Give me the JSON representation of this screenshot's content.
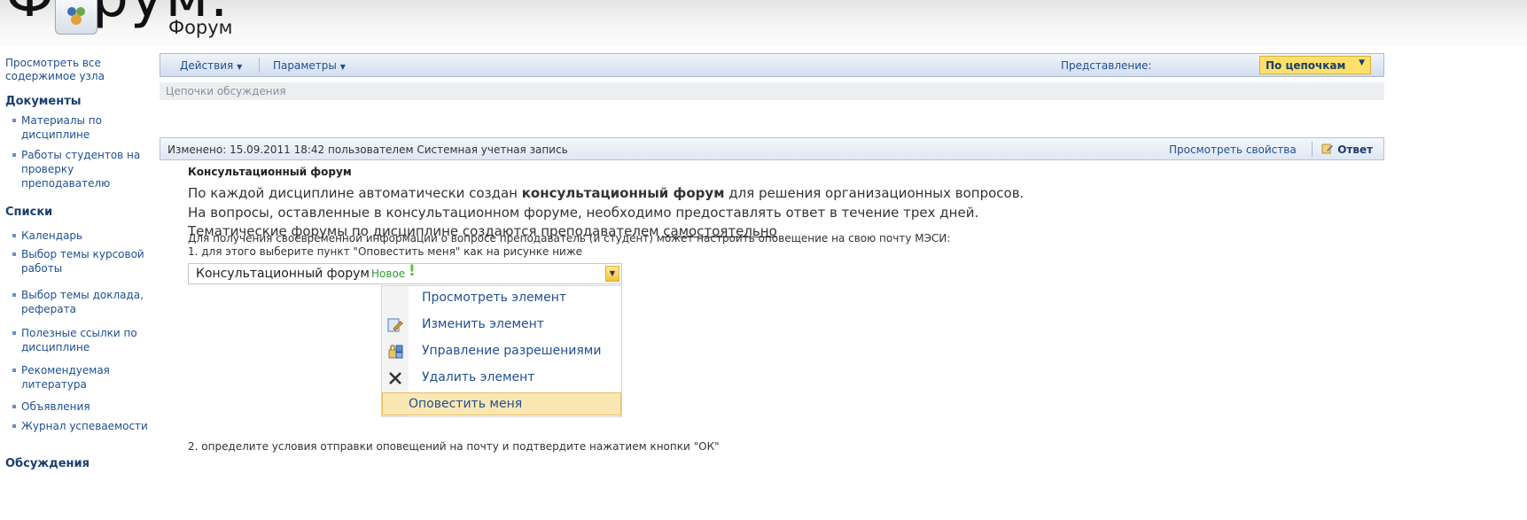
{
  "slide": {
    "overlay_title": "Форум."
  },
  "header": {
    "page_title": "Форум"
  },
  "nav": {
    "view_all": "Просмотреть все содержимое узла",
    "sections": [
      {
        "title": "Документы",
        "items": [
          "Материалы по дисциплине",
          "Работы студентов на проверку преподавателю"
        ]
      },
      {
        "title": "Списки",
        "items": [
          "Календарь",
          "Выбор темы курсовой работы",
          "Выбор темы доклада, реферата",
          "Полезные ссылки по дисциплине",
          "Рекомендуемая литература",
          "Объявления",
          "Журнал успеваемости"
        ]
      },
      {
        "title": "Обсуждения",
        "items": []
      }
    ]
  },
  "toolbar": {
    "actions": "Действия",
    "settings": "Параметры",
    "view_label": "Представление:",
    "view_value": "По цепочкам"
  },
  "breadcrumb": "Цепочки обсуждения",
  "meta": {
    "modified": "Изменено: 15.09.2011 18:42 пользователем Системная учетная запись",
    "view_properties": "Просмотреть свойства",
    "reply": "Ответ"
  },
  "post": {
    "title": "Консультационный форум",
    "p1_a": "По каждой дисциплине автоматически создан ",
    "p1_b": "консультационный форум",
    "p1_c": " для решения организационных вопросов.",
    "p2": "На вопросы, оставленные в консультационном форуме, необходимо предоставлять ответ в течение трех дней.",
    "p3_a": "Тематические форумы по дисциплине создаются преподавателем ",
    "p3_b": "самостоятельно",
    "note1": "Для получения своевременной информации о вопросе преподаватель (и студент) может настроить оповещение на свою почту МЭСИ:",
    "note2": "1. для этого выберите пункт \"Оповестить меня\" как на рисунке ниже",
    "note3": "2. определите условия отправки оповещений на почту и подтвердите нажатием кнопки \"ОК\""
  },
  "dropdown": {
    "label": "Консультационный форум",
    "new_tag": "Новое",
    "new_mark": "!",
    "menu": [
      "Просмотреть элемент",
      "Изменить элемент",
      "Управление разрешениями",
      "Удалить элемент",
      "Оповестить меня"
    ]
  }
}
